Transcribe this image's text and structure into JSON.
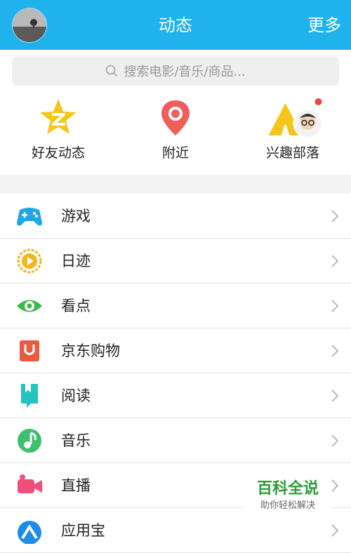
{
  "header": {
    "title": "动态",
    "more_label": "更多"
  },
  "search": {
    "placeholder": "搜索电影/音乐/商品..."
  },
  "quick_actions": [
    {
      "label": "好友动态",
      "icon": "qzone-star-icon"
    },
    {
      "label": "附近",
      "icon": "location-pin-icon"
    },
    {
      "label": "兴趣部落",
      "icon": "tent-icon",
      "badge": "red-dot"
    }
  ],
  "menu": [
    {
      "label": "游戏",
      "icon": "gamepad-icon"
    },
    {
      "label": "日迹",
      "icon": "play-circle-icon"
    },
    {
      "label": "看点",
      "icon": "eye-icon"
    },
    {
      "label": "京东购物",
      "icon": "shopping-bag-icon"
    },
    {
      "label": "阅读",
      "icon": "book-icon"
    },
    {
      "label": "音乐",
      "icon": "music-note-icon"
    },
    {
      "label": "直播",
      "icon": "video-camera-icon"
    },
    {
      "label": "应用宝",
      "icon": "app-store-icon"
    }
  ],
  "watermark": {
    "title": "百科全说",
    "subtitle": "助你轻松解决"
  },
  "colors": {
    "header": "#1fb2ec",
    "background": "#f3f3f3"
  }
}
